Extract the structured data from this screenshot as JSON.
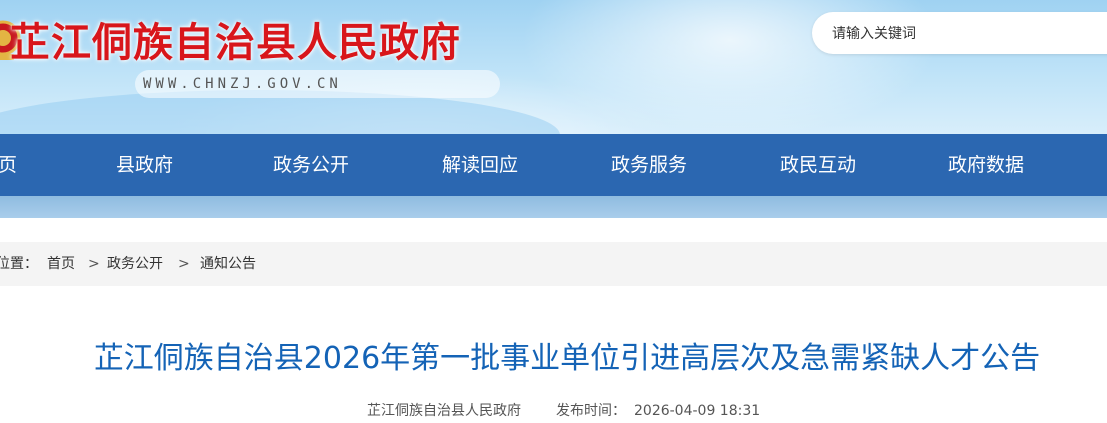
{
  "header": {
    "site_title": "芷江侗族自治县人民政府",
    "site_url": "WWW.CHNZJ.GOV.CN",
    "search_placeholder": "请输入关键词"
  },
  "nav": {
    "items": [
      "页",
      "县政府",
      "政务公开",
      "解读回应",
      "政务服务",
      "政民互动",
      "政府数据"
    ]
  },
  "breadcrumb": {
    "prefix": "位置：",
    "items": [
      "首页",
      "政务公开",
      "通知公告"
    ],
    "separator": ">"
  },
  "article": {
    "title": "芷江侗族自治县2026年第一批事业单位引进高层次及急需紧缺人才公告",
    "source": "芷江侗族自治县人民政府",
    "publish_label": "发布时间：",
    "publish_time": "2026-04-09 18:31"
  },
  "colors": {
    "title_red": "#d8161b",
    "nav_blue": "#2b67b1",
    "article_title_blue": "#1463b6"
  }
}
